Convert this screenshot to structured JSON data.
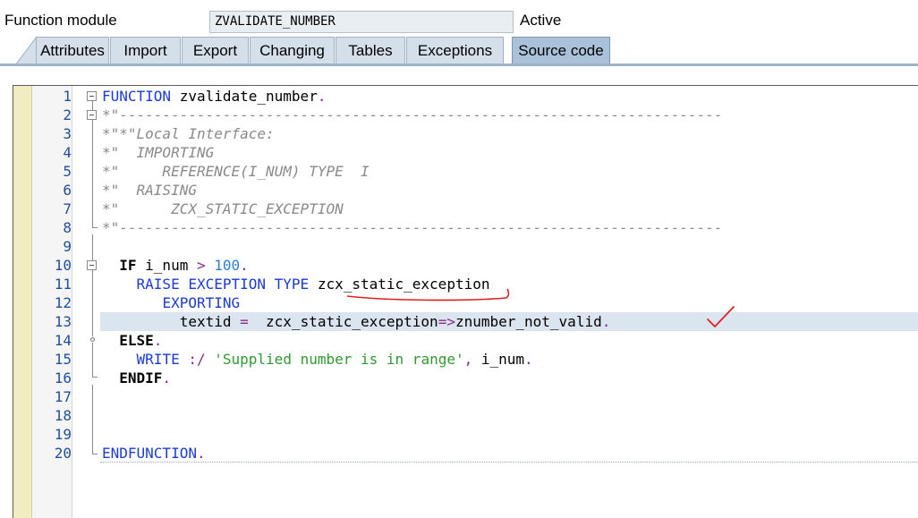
{
  "header": {
    "label": "Function module",
    "name": "ZVALIDATE_NUMBER",
    "status": "Active"
  },
  "tabs": [
    {
      "label": "Attributes"
    },
    {
      "label": "Import"
    },
    {
      "label": "Export"
    },
    {
      "label": "Changing"
    },
    {
      "label": "Tables"
    },
    {
      "label": "Exceptions"
    },
    {
      "label": "Source code",
      "active": true
    }
  ],
  "editor": {
    "highlighted_line": 13,
    "lines": [
      {
        "n": "1",
        "tokens": [
          [
            "kw",
            "FUNCTION"
          ],
          [
            "id",
            " zvalidate_number"
          ],
          [
            "op",
            "."
          ]
        ]
      },
      {
        "n": "2",
        "tokens": [
          [
            "cm",
            "*\"----------------------------------------------------------------------"
          ]
        ]
      },
      {
        "n": "3",
        "tokens": [
          [
            "cm",
            "*\"*\"Local Interface:"
          ]
        ]
      },
      {
        "n": "4",
        "tokens": [
          [
            "cm",
            "*\"  IMPORTING"
          ]
        ]
      },
      {
        "n": "5",
        "tokens": [
          [
            "cm",
            "*\"     REFERENCE(I_NUM) TYPE  I"
          ]
        ]
      },
      {
        "n": "6",
        "tokens": [
          [
            "cm",
            "*\"  RAISING"
          ]
        ]
      },
      {
        "n": "7",
        "tokens": [
          [
            "cm",
            "*\"      ZCX_STATIC_EXCEPTION"
          ]
        ]
      },
      {
        "n": "8",
        "tokens": [
          [
            "cm",
            "*\"----------------------------------------------------------------------"
          ]
        ]
      },
      {
        "n": "9",
        "tokens": []
      },
      {
        "n": "10",
        "tokens": [
          [
            "id",
            "  "
          ],
          [
            "kwb",
            "IF"
          ],
          [
            "id",
            " i_num "
          ],
          [
            "op",
            ">"
          ],
          [
            "id",
            " "
          ],
          [
            "num",
            "100"
          ],
          [
            "op",
            "."
          ]
        ]
      },
      {
        "n": "11",
        "tokens": [
          [
            "id",
            "    "
          ],
          [
            "kw",
            "RAISE EXCEPTION TYPE"
          ],
          [
            "id",
            " zcx_static_exception"
          ]
        ]
      },
      {
        "n": "12",
        "tokens": [
          [
            "id",
            "       "
          ],
          [
            "kw",
            "EXPORTING"
          ]
        ]
      },
      {
        "n": "13",
        "tokens": [
          [
            "id",
            "         textid "
          ],
          [
            "op",
            "="
          ],
          [
            "id",
            "  zcx_static_exception"
          ],
          [
            "op",
            "=>"
          ],
          [
            "id",
            "znumber_not_valid"
          ],
          [
            "op",
            "."
          ]
        ]
      },
      {
        "n": "14",
        "tokens": [
          [
            "id",
            "  "
          ],
          [
            "kwb",
            "ELSE"
          ],
          [
            "op",
            "."
          ]
        ]
      },
      {
        "n": "15",
        "tokens": [
          [
            "id",
            "    "
          ],
          [
            "kw",
            "WRITE"
          ],
          [
            "id",
            " "
          ],
          [
            "op",
            ":/"
          ],
          [
            "id",
            " "
          ],
          [
            "str",
            "'Supplied number is in range'"
          ],
          [
            "op",
            ","
          ],
          [
            "id",
            " i_num"
          ],
          [
            "op",
            "."
          ]
        ]
      },
      {
        "n": "16",
        "tokens": [
          [
            "id",
            "  "
          ],
          [
            "kwb",
            "ENDIF"
          ],
          [
            "op",
            "."
          ]
        ]
      },
      {
        "n": "17",
        "tokens": []
      },
      {
        "n": "18",
        "tokens": []
      },
      {
        "n": "19",
        "tokens": []
      },
      {
        "n": "20",
        "tokens": [
          [
            "kw",
            "ENDFUNCTION"
          ],
          [
            "op",
            "."
          ]
        ]
      }
    ]
  },
  "colors": {
    "tab_active": "#a9c1d9",
    "keyword": "#1b3ad6",
    "comment": "#8a8a8a",
    "string": "#2e9b2e",
    "annotation": "#e02020"
  }
}
